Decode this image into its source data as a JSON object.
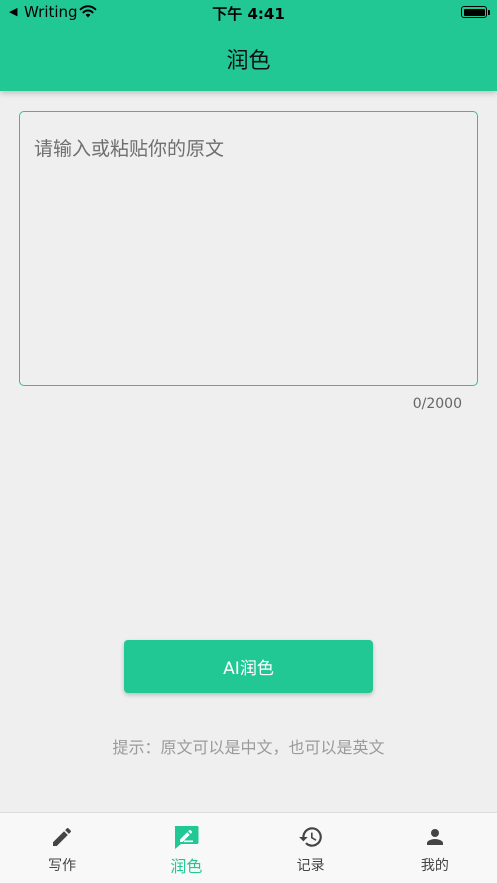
{
  "status_bar": {
    "back_glyph": "◀",
    "app_name": "Writing",
    "time": "下午 4:41"
  },
  "header": {
    "title": "润色"
  },
  "editor": {
    "placeholder": "请输入或粘贴你的原文",
    "value": "",
    "counter": "0/2000"
  },
  "action": {
    "button_label": "AI润色",
    "tip": "提示：原文可以是中文，也可以是英文"
  },
  "tabs": [
    {
      "label": "写作",
      "icon": "pencil-icon",
      "active": false
    },
    {
      "label": "润色",
      "icon": "polish-icon",
      "active": true
    },
    {
      "label": "记录",
      "icon": "history-icon",
      "active": false
    },
    {
      "label": "我的",
      "icon": "person-icon",
      "active": false
    }
  ],
  "colors": {
    "accent": "#22c894",
    "background": "#efefef",
    "tab_inactive": "#444444"
  }
}
